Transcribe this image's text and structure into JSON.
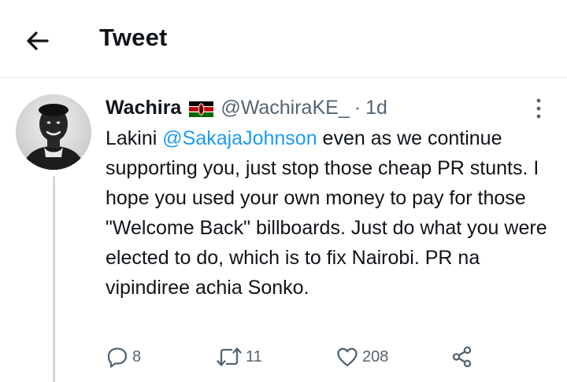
{
  "header": {
    "title": "Tweet",
    "back_icon": "arrow-left-icon"
  },
  "tweet": {
    "author_name": "Wachira",
    "flag_icon": "kenya-flag-icon",
    "handle": "@WachiraKE_",
    "separator": "·",
    "time": "1d",
    "text_before_mention": "Lakini ",
    "mention": "@SakajaJohnson",
    "text_after_mention": " even as we continue supporting you, just stop those cheap PR stunts. I hope you used your own money to pay for those \"Welcome Back\" billboards. Just do what you were elected to do, which is to fix Nairobi. PR na vipindiree achia Sonko.",
    "more_icon": "more-vertical-icon",
    "avatar_icon": "profile-photo"
  },
  "actions": {
    "replies": "8",
    "retweets": "11",
    "likes": "208",
    "reply_icon": "reply-icon",
    "retweet_icon": "retweet-icon",
    "like_icon": "heart-icon",
    "share_icon": "share-icon"
  },
  "colors": {
    "text": "#0f1419",
    "secondary": "#536471",
    "link": "#1d9bf0",
    "divider": "#e6e9ec"
  }
}
